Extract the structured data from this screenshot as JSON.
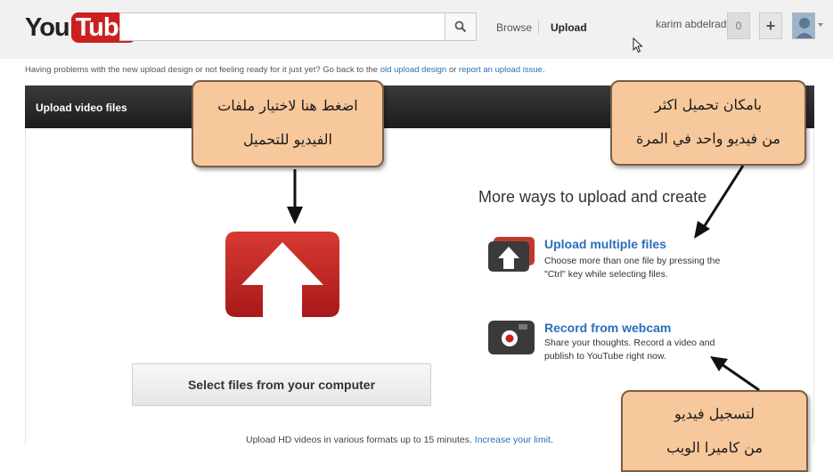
{
  "header": {
    "logo": {
      "you": "You",
      "tube": "Tube"
    },
    "search": {
      "value": "",
      "icon": "search-icon"
    },
    "nav": {
      "browse": "Browse",
      "upload": "Upload"
    },
    "user": {
      "name": "karim abdelrady",
      "notifications": "0",
      "add": "+"
    }
  },
  "notice": {
    "text": "Having problems with the new upload design or not feeling ready for it just yet? Go back to the",
    "link1": "old upload design",
    "middle": "or",
    "link2": "report an upload issue",
    "end": "."
  },
  "upload_panel": {
    "title": "Upload video files",
    "select_button": "Select files from your computer",
    "footer_text": "Upload HD videos in various formats up to 15 minutes.",
    "footer_link": "Increase your limit",
    "footer_end": "."
  },
  "more_ways": {
    "heading": "More ways to upload and create",
    "options": [
      {
        "title": "Upload multiple files",
        "description": "Choose more than one file by pressing the \"Ctrl\" key while selecting files.",
        "icon": "multi-upload-icon"
      },
      {
        "title": "Record from webcam",
        "description": "Share your thoughts. Record a video and publish to YouTube right now.",
        "icon": "webcam-icon"
      }
    ]
  },
  "callouts": [
    {
      "line1": "اضغط هنا لاختيار ملفات",
      "line2": "الفيديو للتحميل"
    },
    {
      "line1": "بامكان تحميل اكثر",
      "line2": "من فيديو واحد في المرة"
    },
    {
      "line1": "لتسجيل فيديو",
      "line2": "من كاميرا الويب"
    }
  ],
  "colors": {
    "brand_red": "#cc1f1f",
    "link_blue": "#2a6ebb",
    "callout_fill": "#f7c89b",
    "header_dark": "#1c1c1c"
  }
}
